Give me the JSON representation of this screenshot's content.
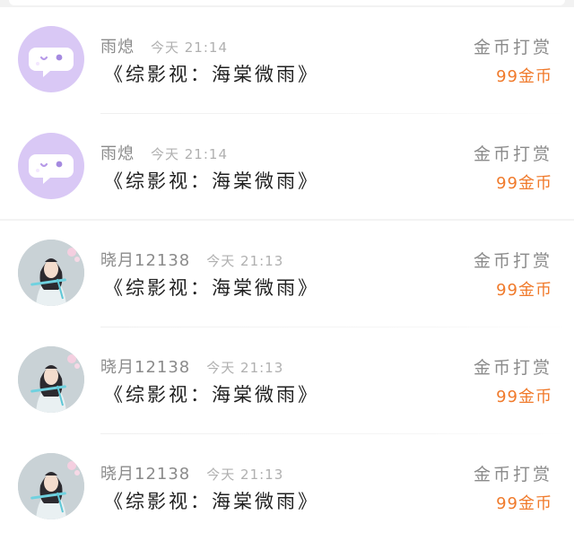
{
  "items": [
    {
      "user": "雨熄",
      "time": "今天 21:14",
      "title": "《综影视：海棠微雨》",
      "action": "金币打赏",
      "reward": "99金币",
      "avatar": "bot-face-icon"
    },
    {
      "user": "雨熄",
      "time": "今天 21:14",
      "title": "《综影视：海棠微雨》",
      "action": "金币打赏",
      "reward": "99金币",
      "avatar": "bot-face-icon"
    },
    {
      "user": "晓月12138",
      "time": "今天 21:13",
      "title": "《综影视：海棠微雨》",
      "action": "金币打赏",
      "reward": "99金币",
      "avatar": "portrait-avatar"
    },
    {
      "user": "晓月12138",
      "time": "今天 21:13",
      "title": "《综影视：海棠微雨》",
      "action": "金币打赏",
      "reward": "99金币",
      "avatar": "portrait-avatar"
    },
    {
      "user": "晓月12138",
      "time": "今天 21:13",
      "title": "《综影视：海棠微雨》",
      "action": "金币打赏",
      "reward": "99金币",
      "avatar": "portrait-avatar"
    }
  ],
  "colors": {
    "reward": "#f07a2b",
    "avatar_bg": "#d9c8f5",
    "muted": "#8b8b8b"
  }
}
